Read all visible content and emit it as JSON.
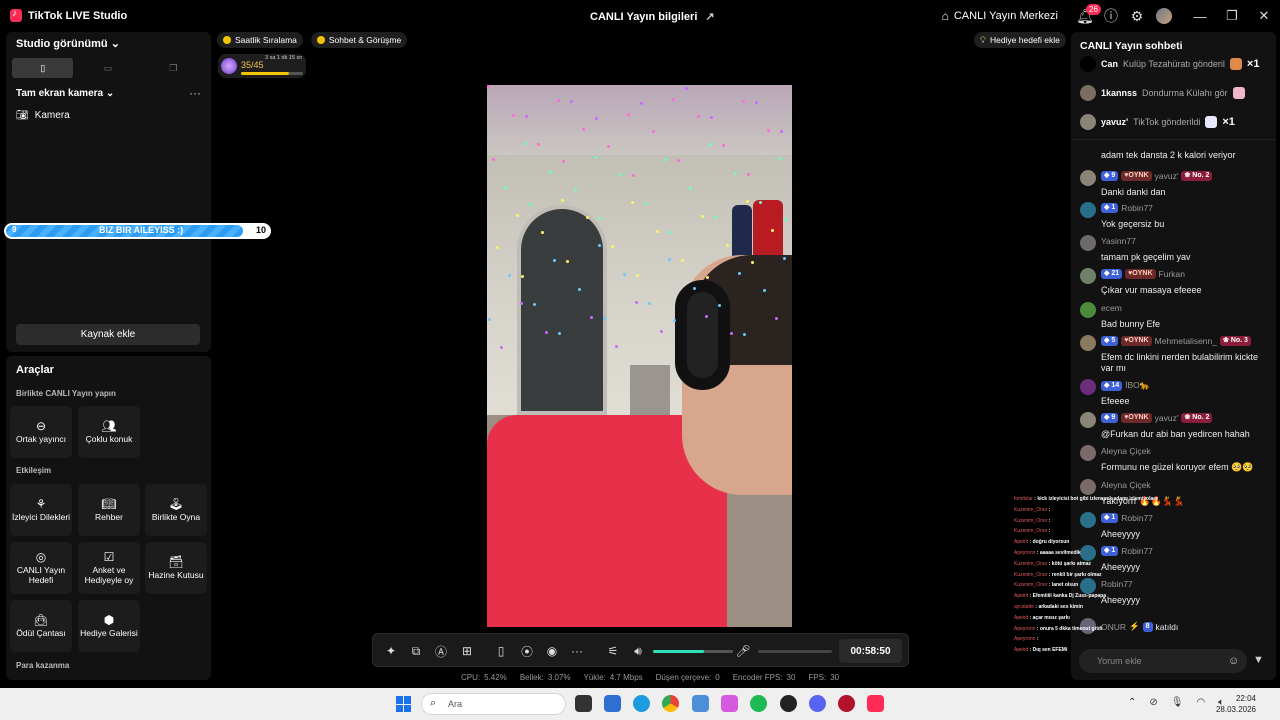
{
  "titlebar": {
    "app_name": "TikTok LIVE Studio",
    "center_title": "CANLI Yayın bilgileri",
    "hub_label": "CANLI Yayın Merkezi",
    "notif_count": "26"
  },
  "left": {
    "studio_view": "Studio görünümü",
    "scene_title": "Tam ekran kamera",
    "source_camera": "Kamera",
    "progress_left": "9",
    "progress_center": "BIZ BIR AILEYISS :)",
    "progress_right": "10",
    "progress_fraction": 0.9,
    "add_source": "Kaynak ekle"
  },
  "tools": {
    "title": "Araçlar",
    "sec_collab": "Birlikte CANLI Yayın yapın",
    "cohost": "Ortak yayıncı",
    "multi_guest": "Çoklu konuk",
    "sec_interact": "Etkileşim",
    "viewer_wishes": "İzleyici Dilekleri",
    "guide": "Rehber",
    "play_together": "Birlikte Oyna",
    "live_goal": "CANLI Yayın Hedefi",
    "poll": "Anket ve Hediyeyle oy",
    "treasure": "Hazine Kutusu",
    "reward_bag": "Ödül Çantası",
    "gift_gallery": "Hediye Galerisi",
    "sec_earn": "Para kazanma"
  },
  "stage": {
    "chip1": "Saatlik Sıralama",
    "chip2": "Sohbet & Görüşme",
    "gift_goal": "Hediye hedefi ekle",
    "level_count": "35/45",
    "level_sub": "3 sa 1 dk 15 sn",
    "level_fraction": 0.78
  },
  "controls": {
    "timer": "00:58:50",
    "volume_fraction": 0.64
  },
  "stats": [
    {
      "label": "CPU:",
      "value": "5.42%"
    },
    {
      "label": "Bellek:",
      "value": "3.07%"
    },
    {
      "label": "Yükle:",
      "value": "4.7 Mbps"
    },
    {
      "label": "Düşen çerçeve:",
      "value": "0"
    },
    {
      "label": "Encoder FPS:",
      "value": "30"
    },
    {
      "label": "FPS:",
      "value": "30"
    }
  ],
  "chat": {
    "title": "CANLI Yayın sohbeti",
    "gifts": [
      {
        "user": "Can",
        "text": "Kulüp Tezahüratı gönderil",
        "mult": "×1"
      },
      {
        "user": "1kannss",
        "text": "Dondurma Külahı gör",
        "mult": ""
      },
      {
        "user": "yavuz'",
        "text": "TikTok gönderildi",
        "mult": "×1"
      }
    ],
    "partial": "adam tek dansta 2 k kalori veriyor",
    "messages": [
      {
        "level": "9",
        "oynk": "OYNK",
        "user": "yavuz'",
        "no": "No. 2",
        "text": "Danki danki dan"
      },
      {
        "level": "1",
        "oynk": "",
        "user": "Robin77",
        "no": "",
        "text": "Yok geçersiz bu"
      },
      {
        "level": "",
        "oynk": "",
        "user": "Yasinn77",
        "no": "",
        "text": "tamam pk geçelim yav"
      },
      {
        "level": "21",
        "oynk": "OYNK",
        "user": "Furkan",
        "no": "",
        "text": "Çıkar vur masaya efeeee"
      },
      {
        "level": "",
        "oynk": "",
        "user": "ecem",
        "no": "",
        "text": "Bad bunny Efe"
      },
      {
        "level": "5",
        "oynk": "OYNK",
        "user": "Mehmetalisenn_",
        "no": "No. 3",
        "text": "Efem dc linkini nerden bulabilirim kickte var mı"
      },
      {
        "level": "14",
        "oynk": "",
        "user": "İBO🐆",
        "no": "",
        "text": "Efeeee"
      },
      {
        "level": "9",
        "oynk": "OYNK",
        "user": "yavuz'",
        "no": "No. 2",
        "text": "@Furkan dur abi ban yedircen hahah"
      },
      {
        "level": "",
        "oynk": "",
        "user": "Aleyna Çiçek",
        "no": "",
        "text": "Formunu ne güzel koruyor efem 🥺🥺"
      },
      {
        "level": "",
        "oynk": "",
        "user": "Aleyna Çiçek",
        "no": "",
        "text": "Yakıyorrr 🔥🔥💃💃"
      },
      {
        "level": "1",
        "oynk": "",
        "user": "Robin77",
        "no": "",
        "text": "Aheeyyyy"
      },
      {
        "level": "1",
        "oynk": "",
        "user": "Robin77",
        "no": "",
        "text": "Aheeyyyy"
      },
      {
        "level": "",
        "oynk": "",
        "user": "Robin77",
        "no": "",
        "text": "Aheeyyyy"
      }
    ],
    "join_user": "ONUR",
    "join_level": "8",
    "join_text": "katıldı",
    "input_placeholder": "Yorum ekle"
  },
  "overlay_chat": [
    {
      "u": "fomilolar",
      "t": ": kick izleyicisi bot gibi izlenecek adamı izlemiyolaer"
    },
    {
      "u": "Kuzenim_Onur",
      "t": ":"
    },
    {
      "u": "Kuzenim_Onur",
      "t": ":"
    },
    {
      "u": "Kuzenim_Onur",
      "t": ":"
    },
    {
      "u": "Apeirit",
      "t": ": doğru diyorsun"
    },
    {
      "u": "Apeyronn",
      "t": ": aaaaa sevilmedik"
    },
    {
      "u": "Kuzenim_Onur",
      "t": ": kötü şarkı atmaz"
    },
    {
      "u": "Kuzenim_Onur",
      "t": ": renkli bir şarkı olmaz"
    },
    {
      "u": "Kuzenim_Onur",
      "t": ": lanet olsun"
    },
    {
      "u": "Apeirit",
      "t": ": Efemiiiii kanka Dj Zuss-papapa"
    },
    {
      "u": "aycalatte",
      "t": ": arkadaki ses kimin"
    },
    {
      "u": "Apeirit",
      "t": ": açar mısız şarkı"
    },
    {
      "u": "Apeyronn",
      "t": ": onura 5 dkka timeout gridi"
    },
    {
      "u": "Apeyronn",
      "t": ":"
    },
    {
      "u": "Apeirit",
      "t": ": Dıq sen EFEMi"
    }
  ],
  "taskbar": {
    "search": "Ara",
    "time": "22:04",
    "date": "28.03.2026"
  }
}
